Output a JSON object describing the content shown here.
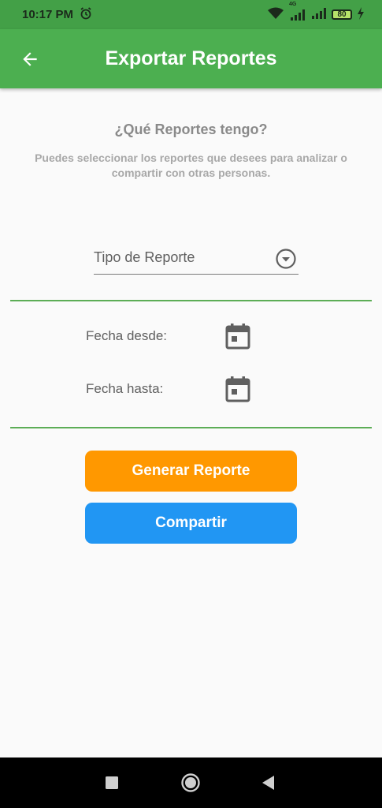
{
  "status_bar": {
    "time": "10:17 PM",
    "network_label": "4G",
    "battery_level": "80",
    "icons": [
      "alarm-icon",
      "wifi-icon",
      "signal-icon",
      "battery-icon",
      "charging-icon"
    ]
  },
  "app_bar": {
    "title": "Exportar Reportes",
    "back_icon": "arrow-back-icon"
  },
  "content": {
    "heading": "¿Qué Reportes tengo?",
    "description": "Puedes seleccionar los reportes que desees  para analizar o compartir con otras personas.",
    "report_type": {
      "label": "Tipo de Reporte",
      "icon": "dropdown-circle-icon"
    },
    "date_from_label": "Fecha desde:",
    "date_to_label": "Fecha hasta:",
    "generate_button": "Generar Reporte",
    "share_button": "Compartir"
  },
  "colors": {
    "status_bar": "#43a047",
    "app_bar": "#4caf50",
    "divider": "#5cad56",
    "generate": "#ff9800",
    "share": "#2196f3",
    "background": "#fafafa"
  },
  "nav_bar": {
    "icons": [
      "recents-square-icon",
      "home-circle-icon",
      "back-triangle-icon"
    ]
  }
}
